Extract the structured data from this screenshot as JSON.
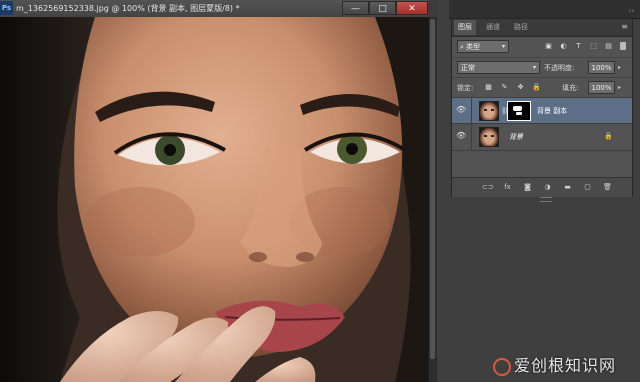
{
  "document": {
    "app_icon": "Ps",
    "title": "m_1362569152338.jpg @ 100% (背景 副本, 图层蒙版/8) *",
    "minimize_label": "—",
    "maximize_label": "□",
    "close_label": "✕"
  },
  "layers_panel": {
    "tabs": [
      "图层",
      "通道",
      "路径"
    ],
    "menu_icon": "panel-menu-icon",
    "filter": {
      "kind_label": "类型",
      "icons": [
        "image-filter-icon",
        "adjustment-filter-icon",
        "type-filter-icon",
        "shape-filter-icon",
        "smart-object-filter-icon"
      ]
    },
    "blend_mode": "正常",
    "opacity_label": "不透明度:",
    "opacity_value": "100%",
    "lock_label": "锁定:",
    "fill_label": "填充:",
    "fill_value": "100%",
    "layers": [
      {
        "name": "背景 副本",
        "visible": true,
        "selected": true,
        "has_mask": true
      },
      {
        "name": "背景",
        "visible": true,
        "selected": false,
        "locked": true
      }
    ],
    "footer_icons": [
      "link-layers-icon",
      "layer-style-icon",
      "add-mask-icon",
      "adjustment-layer-icon",
      "group-icon",
      "new-layer-icon",
      "delete-layer-icon"
    ]
  },
  "watermark": "爱创根知识网",
  "colors": {
    "selected_layer": "#5d6f86",
    "panel_bg": "#535353",
    "close_button": "#b8423c"
  }
}
